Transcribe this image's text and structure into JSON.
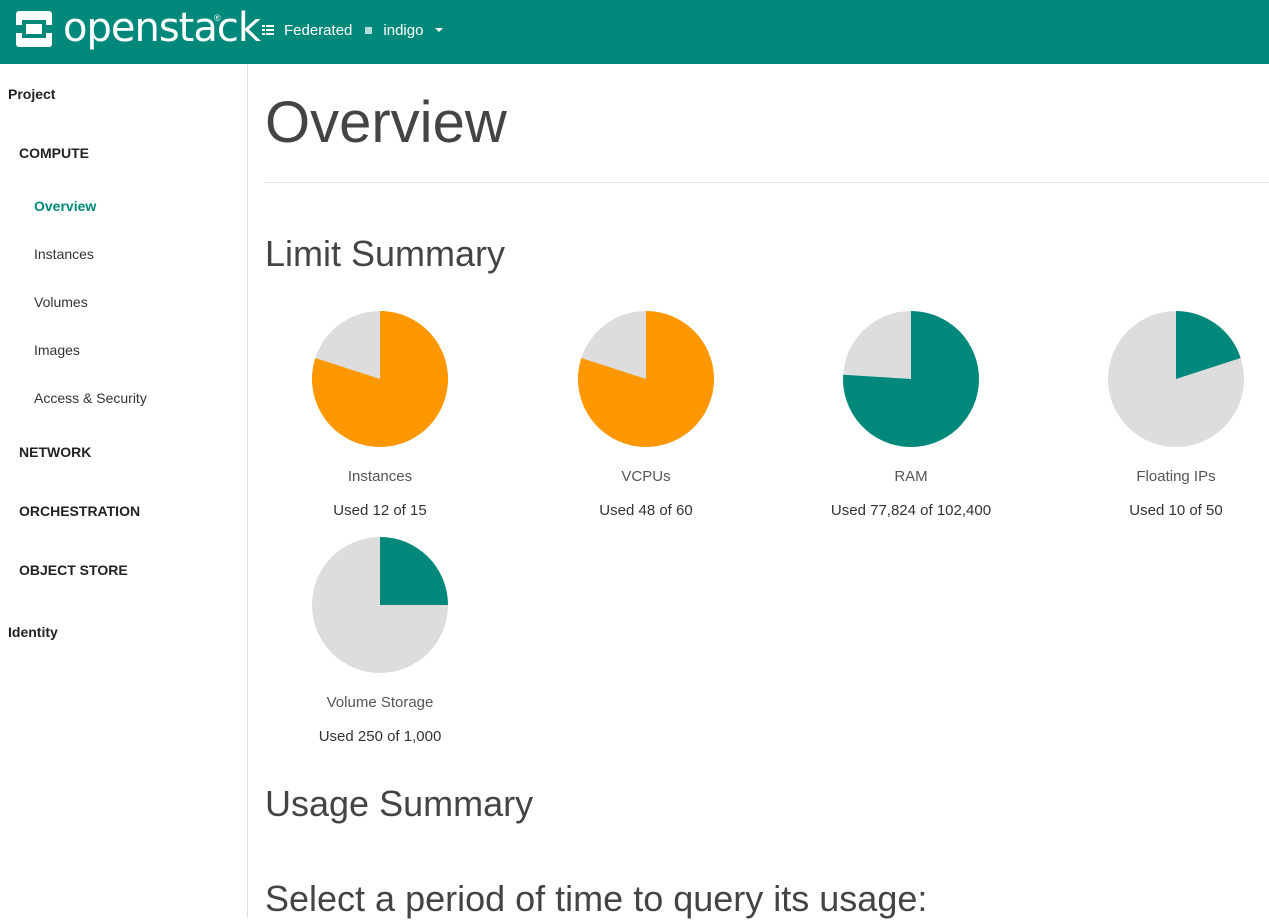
{
  "header": {
    "brand": "openstack",
    "brand_mark": "®",
    "domain": "Federated",
    "project": "indigo",
    "colors": {
      "bar": "#00897b"
    }
  },
  "sidebar": {
    "project_label": "Project",
    "compute_label": "COMPUTE",
    "compute_items": [
      {
        "label": "Overview",
        "active": true
      },
      {
        "label": "Instances"
      },
      {
        "label": "Volumes"
      },
      {
        "label": "Images"
      },
      {
        "label": "Access & Security"
      }
    ],
    "network_label": "NETWORK",
    "orchestration_label": "ORCHESTRATION",
    "object_store_label": "OBJECT STORE",
    "identity_label": "Identity"
  },
  "main": {
    "title": "Overview",
    "limit_summary_heading": "Limit Summary",
    "usage_summary_heading": "Usage Summary",
    "period_heading": "Select a period of time to query its usage:",
    "limits": [
      {
        "name": "Instances",
        "used_text": "Used 12 of 15",
        "used": 12,
        "total": 15,
        "color": "#ff9800"
      },
      {
        "name": "VCPUs",
        "used_text": "Used 48 of 60",
        "used": 48,
        "total": 60,
        "color": "#ff9800"
      },
      {
        "name": "RAM",
        "used_text": "Used 77,824 of 102,400",
        "used": 77824,
        "total": 102400,
        "color": "#00897b"
      },
      {
        "name": "Floating IPs",
        "used_text": "Used 10 of 50",
        "used": 10,
        "total": 50,
        "color": "#00897b"
      },
      {
        "name": "Volume Storage",
        "used_text": "Used 250 of 1,000",
        "used": 250,
        "total": 1000,
        "color": "#00897b"
      }
    ],
    "pie_empty_color": "#dddddd"
  }
}
